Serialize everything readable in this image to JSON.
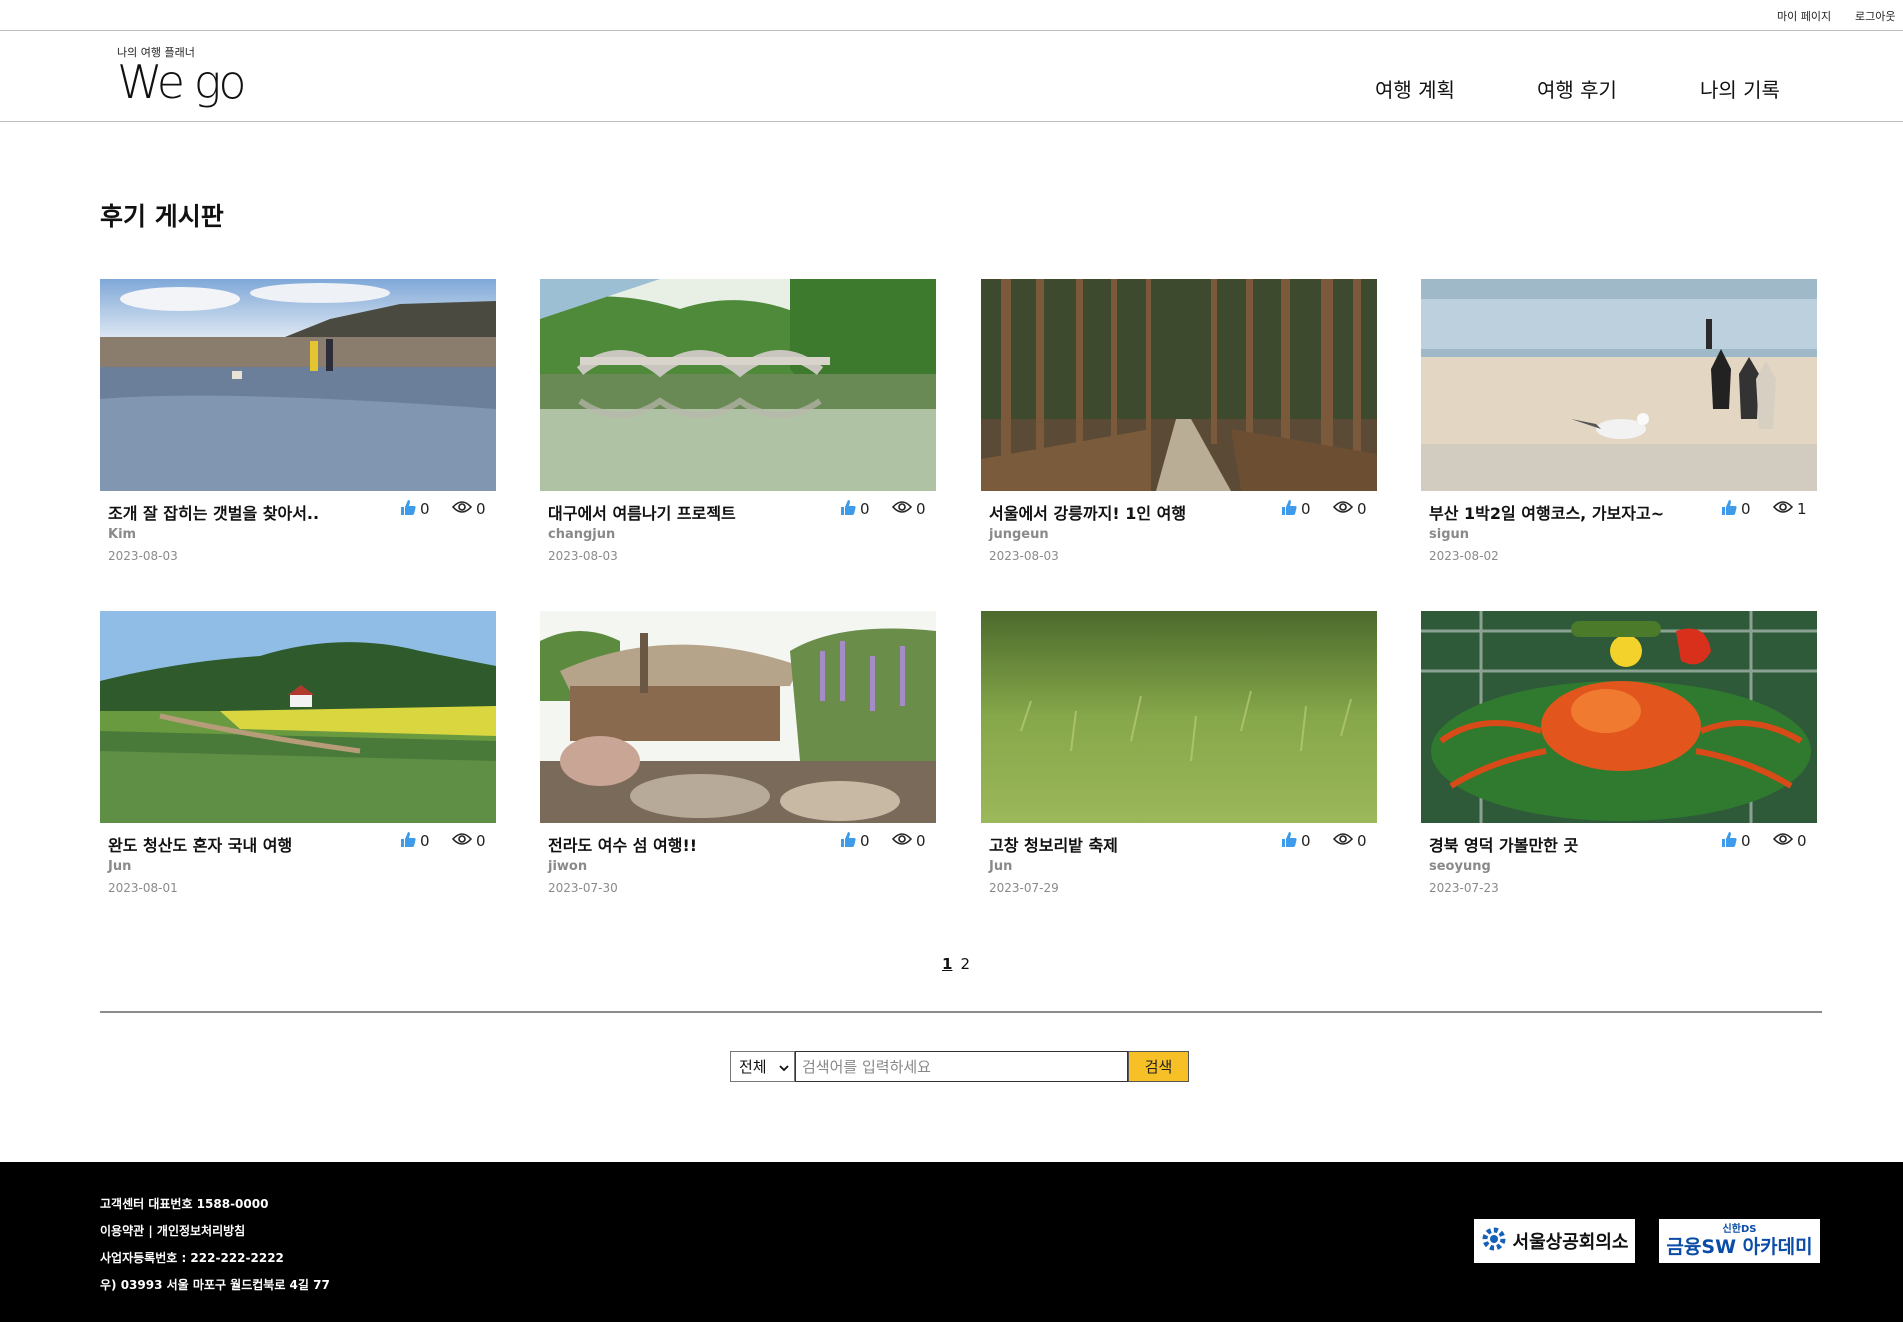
{
  "topbar": {
    "mypage": "마이 페이지",
    "logout": "로그아웃"
  },
  "header": {
    "tagline": "나의 여행 플래너",
    "brand": "We go",
    "nav": {
      "plan": "여행 계획",
      "review": "여행 후기",
      "record": "나의 기록"
    }
  },
  "main": {
    "title": "후기 게시판",
    "posts": [
      {
        "title": "조개 잘 잡히는 갯벌을 찾아서..",
        "likes": "0",
        "views": "0",
        "author": "Kim",
        "date": "2023-08-03",
        "scene": "beach-tidal-flat"
      },
      {
        "title": "대구에서 여름나기 프로젝트",
        "likes": "0",
        "views": "0",
        "author": "changjun",
        "date": "2023-08-03",
        "scene": "stone-bridge-river"
      },
      {
        "title": "서울에서 강릉까지! 1인 여행",
        "likes": "0",
        "views": "0",
        "author": "jungeun",
        "date": "2023-08-03",
        "scene": "pine-forest-path"
      },
      {
        "title": "부산 1박2일 여행코스, 가보자고~",
        "likes": "0",
        "views": "1",
        "author": "sigun",
        "date": "2023-08-02",
        "scene": "seagull-beach"
      },
      {
        "title": "완도 청산도 혼자 국내 여행",
        "likes": "0",
        "views": "0",
        "author": "Jun",
        "date": "2023-08-01",
        "scene": "island-fields"
      },
      {
        "title": "전라도 여수 섬 여행!!",
        "likes": "0",
        "views": "0",
        "author": "jiwon",
        "date": "2023-07-30",
        "scene": "thatched-house"
      },
      {
        "title": "고창 청보리밭 축제",
        "likes": "0",
        "views": "0",
        "author": "Jun",
        "date": "2023-07-29",
        "scene": "barley-field"
      },
      {
        "title": "경북 영덕 가볼만한 곳",
        "likes": "0",
        "views": "0",
        "author": "seoyung",
        "date": "2023-07-23",
        "scene": "snow-crab-dish"
      }
    ],
    "pagination": {
      "pages": [
        "1",
        "2"
      ],
      "current": "1"
    },
    "search": {
      "scope": "전체",
      "placeholder": "검색어를 입력하세요",
      "button": "검색"
    }
  },
  "footer": {
    "line1": "고객센터 대표번호 1588-0000",
    "line2": "이용약관 | 개인정보처리방침",
    "line3": "사업자등록번호 : 222-222-2222",
    "line4": "우) 03993 서울 마포구 월드컵북로 4길 77",
    "chamber": "서울상공회의소",
    "academy_small": "신한DS",
    "academy_big": "금융SW 아카데미"
  },
  "colors": {
    "accent_button": "#f6c026",
    "like_icon": "#3d9be9",
    "footer_bg": "#000000"
  },
  "icons": {
    "like": "thumbs-up-icon",
    "views": "eye-icon",
    "select_arrow": "chevron-down-icon"
  }
}
